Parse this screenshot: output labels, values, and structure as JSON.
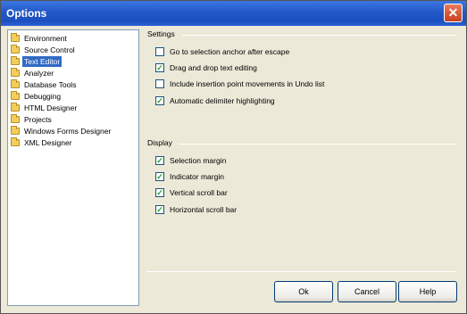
{
  "window": {
    "title": "Options",
    "close_glyph": "✕"
  },
  "tree": {
    "items": [
      {
        "label": "Environment",
        "icon": "folder-icon",
        "selected": false
      },
      {
        "label": "Source Control",
        "icon": "folder-icon",
        "selected": false
      },
      {
        "label": "Text Editor",
        "icon": "folder-icon",
        "selected": true
      },
      {
        "label": "Analyzer",
        "icon": "folder-icon",
        "selected": false
      },
      {
        "label": "Database Tools",
        "icon": "folder-icon",
        "selected": false
      },
      {
        "label": "Debugging",
        "icon": "folder-icon",
        "selected": false
      },
      {
        "label": "HTML Designer",
        "icon": "folder-icon",
        "selected": false
      },
      {
        "label": "Projects",
        "icon": "folder-icon",
        "selected": false
      },
      {
        "label": "Windows Forms Designer",
        "icon": "folder-icon",
        "selected": false
      },
      {
        "label": "XML Designer",
        "icon": "folder-icon",
        "selected": false
      }
    ]
  },
  "settings": {
    "label": "Settings",
    "options": [
      {
        "label": "Go to selection anchor after escape",
        "checked": false
      },
      {
        "label": "Drag and drop text editing",
        "checked": true
      },
      {
        "label": "Include insertion point movements in Undo list",
        "checked": false
      },
      {
        "label": "Automatic delimiter highlighting",
        "checked": true
      }
    ]
  },
  "display": {
    "label": "Display",
    "options": [
      {
        "label": "Selection margin",
        "checked": true
      },
      {
        "label": "Indicator margin",
        "checked": true
      },
      {
        "label": "Vertical scroll bar",
        "checked": true
      },
      {
        "label": "Horizontal scroll bar",
        "checked": true
      }
    ]
  },
  "buttons": {
    "ok": "Ok",
    "cancel": "Cancel",
    "help": "Help"
  },
  "colors": {
    "titlebar": "#2258c8",
    "selection": "#316ac5",
    "checkmark": "#21a121"
  }
}
